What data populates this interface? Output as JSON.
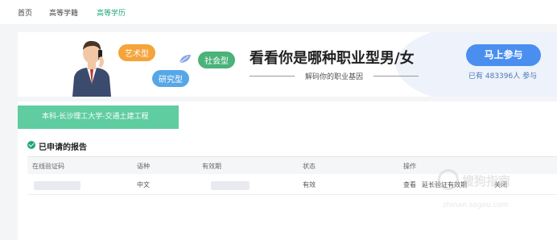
{
  "nav": {
    "home": "首页",
    "higher_ed_status": "高等学籍",
    "higher_ed_degree": "高等学历"
  },
  "banner": {
    "tags": {
      "art": "艺术型",
      "social": "社会型",
      "research": "研究型"
    },
    "headline": "看看你是哪种职业型男/女",
    "subline": "解码你的职业基因",
    "join_button": "马上参与",
    "participants_text": "已有 483396人 参与"
  },
  "content": {
    "school_tab": "本科-长沙理工大学-交通土建工程",
    "section_title": "已申请的报告",
    "table": {
      "headers": [
        "在线验证码",
        "语种",
        "有效期",
        "状态",
        "操作"
      ],
      "rows": [
        {
          "language": "中文",
          "status": "有效",
          "actions": [
            "查看",
            "延长验证有效期",
            "关闭"
          ]
        }
      ]
    }
  },
  "watermark": {
    "text": "搜狗指南",
    "url": "zhinan.sogou.com"
  },
  "colors": {
    "accent_green": "#21a67a",
    "tab_green": "#5fcda0",
    "primary_blue": "#4a8ef0",
    "tag_orange": "#f5a33b",
    "tag_green": "#4ab27a",
    "tag_blue": "#56a7e7"
  }
}
